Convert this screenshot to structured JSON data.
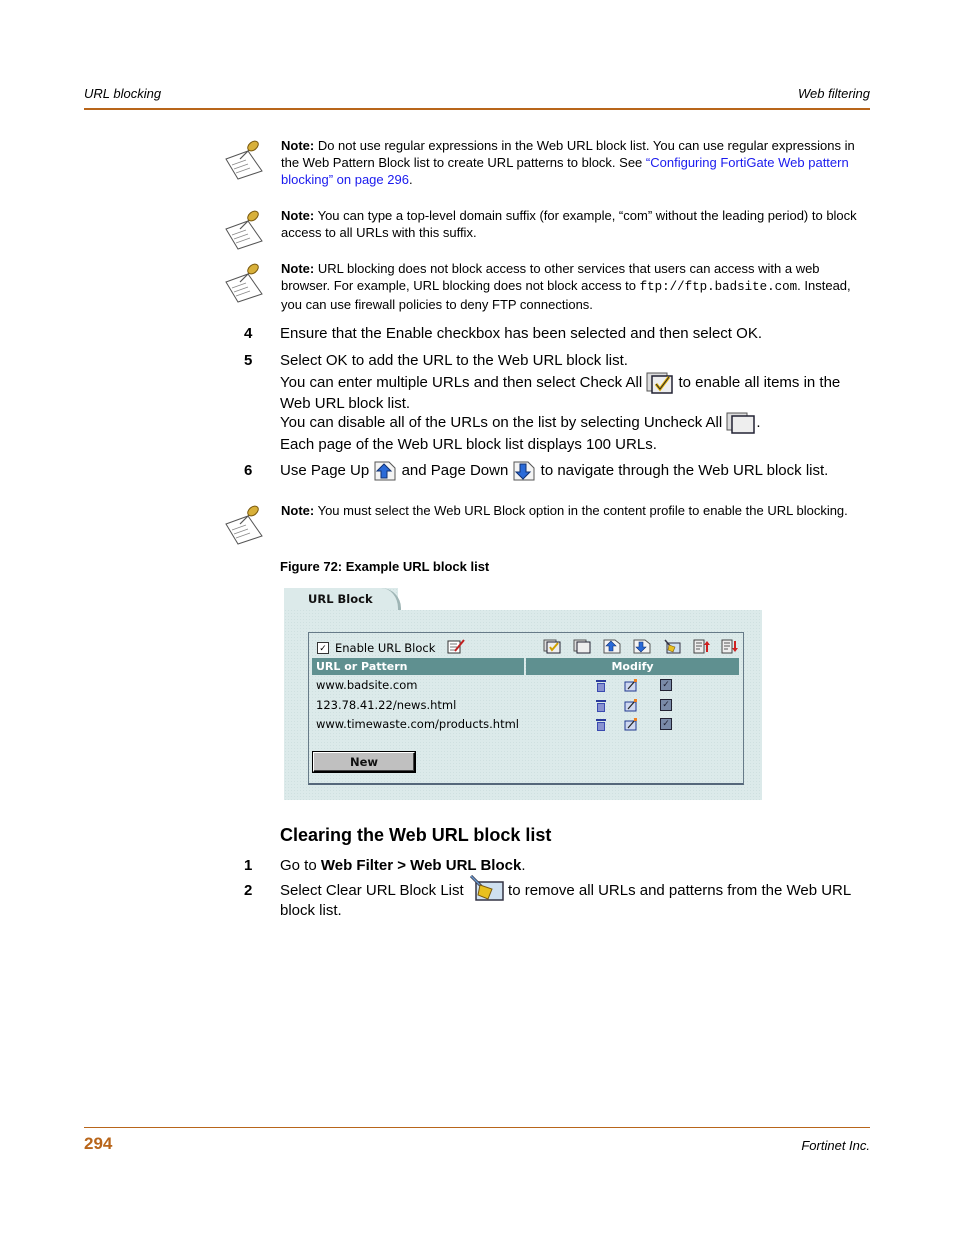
{
  "header": {
    "left": "URL blocking",
    "right": "Web filtering"
  },
  "footer": {
    "page_number": "294",
    "company": "Fortinet Inc."
  },
  "notes": [
    {
      "label": "Note:",
      "text_before": " Do not use regular expressions in the Web URL block list. You can use regular expressions in the Web Pattern Block list to create URL patterns to block. See ",
      "link": "“Configuring FortiGate Web pattern blocking” on page 296",
      "text_after": "."
    },
    {
      "label": "Note:",
      "text": " You can type a top-level domain suffix (for example, “com” without the leading period) to block access to all URLs with this suffix."
    },
    {
      "label": "Note:",
      "text_before": " URL blocking does not block access to other services that users can access with a web browser. For example, URL blocking does not block access to ",
      "code": "ftp://ftp.badsite.com",
      "text_after": ". Instead, you can use firewall policies to deny FTP connections."
    },
    {
      "label": "Note:",
      "text": " You must select the Web URL Block option in the content profile to enable the URL blocking."
    }
  ],
  "steps": [
    {
      "num": "4",
      "text": "Ensure that the Enable checkbox has been selected and then select OK."
    },
    {
      "num": "5",
      "text": "Select OK to add the URL to the Web URL block list."
    },
    {
      "num": "6",
      "text_before": "Use Page Up ",
      "text_mid": " and Page Down ",
      "text_after": " to navigate through the Web URL block list."
    }
  ],
  "paras": {
    "check_all_before": "You can enter multiple URLs and then select Check All ",
    "check_all_after": " to enable all items in the Web URL block list.",
    "uncheck_before": "You can disable all of the URLs on the list by selecting Uncheck All ",
    "uncheck_after": ".",
    "per_page": "Each page of the Web URL block list displays 100 URLs."
  },
  "figure": {
    "caption": "Figure 72: Example URL block list",
    "tab_label": "URL Block",
    "enable_label": "Enable URL Block",
    "enable_checked": true,
    "columns": [
      "URL or Pattern",
      "Modify"
    ],
    "rows": [
      {
        "url": "www.badsite.com",
        "enabled": true
      },
      {
        "url": "123.78.41.22/news.html",
        "enabled": true
      },
      {
        "url": "www.timewaste.com/products.html",
        "enabled": true
      }
    ],
    "new_button": "New",
    "toolbar_icons": [
      "check-all",
      "uncheck-all",
      "page-up",
      "page-down",
      "clear-list",
      "import",
      "export"
    ]
  },
  "section": {
    "title": "Clearing the Web URL block list",
    "steps": [
      {
        "num": "1",
        "text_before": "Go to ",
        "bold": "Web Filter > Web URL Block",
        "text_after": "."
      },
      {
        "num": "2",
        "text_before": "Select Clear URL Block List ",
        "text_after": " to remove all URLs and patterns from the Web URL block list."
      }
    ]
  }
}
